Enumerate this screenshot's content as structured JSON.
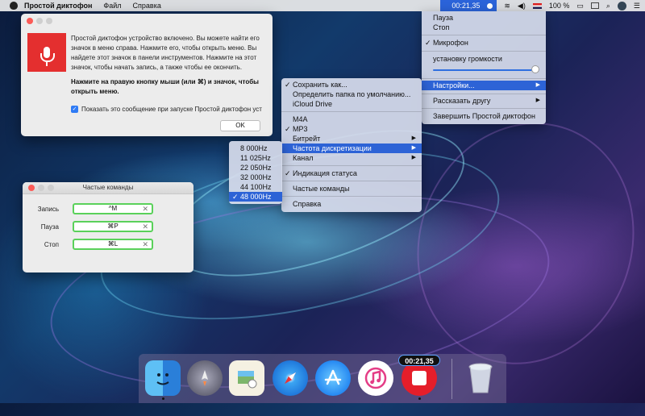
{
  "menubar": {
    "app_name": "Простой диктофон",
    "menus": [
      "Файл",
      "Справка"
    ],
    "timer": "00:21,35",
    "battery": "100 %"
  },
  "info_window": {
    "text1": "Простой диктофон устройство включено. Вы можете найти его значок в меню справа. Нажмите его, чтобы открыть меню. Вы найдете этот значок в панели инструментов. Нажмите на этот значок, чтобы начать запись, а также чтобы ее окончить.",
    "text2": "Нажмите на правую кнопку мыши (или ⌘) и значок, чтобы открыть меню.",
    "checkbox_label": "Показать это сообщение при запуске Простой диктофон уст",
    "ok_label": "OK"
  },
  "commands_window": {
    "title": "Частые команды",
    "rows": [
      {
        "label": "Запись",
        "shortcut": "^M"
      },
      {
        "label": "Пауза",
        "shortcut": "⌘P"
      },
      {
        "label": "Стоп",
        "shortcut": "⌘L"
      }
    ]
  },
  "status_menu": {
    "pause": "Пауза",
    "stop": "Стоп",
    "microphone": "Микрофон",
    "volume_label": "установку громкости",
    "volume_level": 1.0,
    "settings": "Настройки...",
    "tell_friend": "Рассказать другу",
    "quit": "Завершить Простой диктофон"
  },
  "settings_menu": {
    "save_as": "Сохранить как...",
    "default_folder": "Определить папка по умолчанию...",
    "icloud": "iCloud Drive",
    "m4a": "M4A",
    "mp3": "MP3",
    "bitrate": "Битрейт",
    "sample_rate": "Частота дискретизации",
    "channel": "Канал",
    "status_indication": "Индикация статуса",
    "frequent_commands": "Частые команды",
    "help": "Справка"
  },
  "sample_rate_menu": {
    "options": [
      "8 000Hz",
      "11 025Hz",
      "22 050Hz",
      "32 000Hz",
      "44 100Hz",
      "48 000Hz"
    ],
    "selected": "48 000Hz"
  },
  "dock": {
    "badge": "00:21,35",
    "icons": [
      "finder-icon",
      "launchpad-icon",
      "preview-icon",
      "safari-icon",
      "app-store-icon",
      "itunes-icon",
      "recorder-icon",
      "trash-icon"
    ]
  }
}
